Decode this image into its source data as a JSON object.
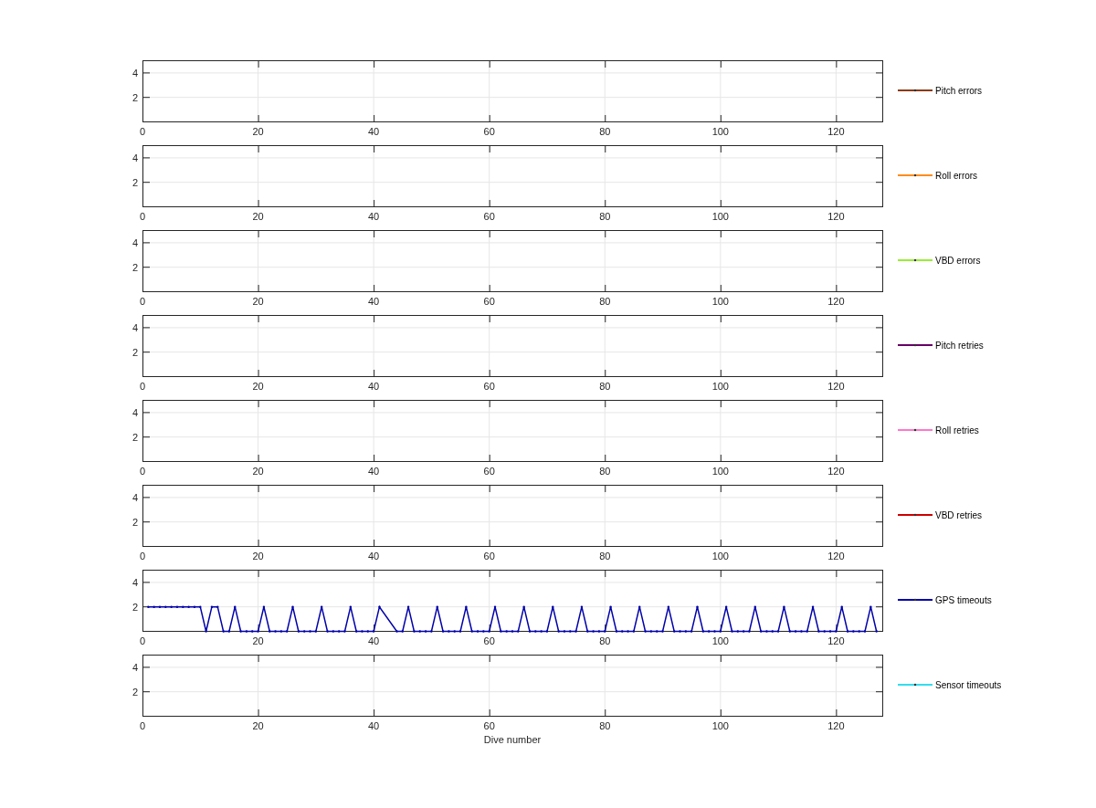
{
  "figure": {
    "subplots": [
      {
        "kind": "empty",
        "yticks": [
          "4",
          "2"
        ],
        "xticks": [
          "0",
          "20",
          "40",
          "60",
          "80",
          "100",
          "120"
        ],
        "legend": {
          "label": "Pitch errors",
          "color": "#8b3a0f"
        }
      },
      {
        "kind": "empty",
        "yticks": [
          "4",
          "2"
        ],
        "xticks": [
          "0",
          "20",
          "40",
          "60",
          "80",
          "100",
          "120"
        ],
        "legend": {
          "label": "Roll errors",
          "color": "#ff8c1a"
        }
      },
      {
        "kind": "empty",
        "yticks": [
          "4",
          "2"
        ],
        "xticks": [
          "0",
          "20",
          "40",
          "60",
          "80",
          "100",
          "120"
        ],
        "legend": {
          "label": "VBD errors",
          "color": "#99ee33"
        }
      },
      {
        "kind": "empty",
        "yticks": [
          "4",
          "2"
        ],
        "xticks": [
          "0",
          "20",
          "40",
          "60",
          "80",
          "100",
          "120"
        ],
        "legend": {
          "label": "Pitch retries",
          "color": "#660066"
        }
      },
      {
        "kind": "empty",
        "yticks": [
          "4",
          "2"
        ],
        "xticks": [
          "0",
          "20",
          "40",
          "60",
          "80",
          "100",
          "120"
        ],
        "legend": {
          "label": "Roll retries",
          "color": "#ff77cc"
        }
      },
      {
        "kind": "empty",
        "yticks": [
          "4",
          "2"
        ],
        "xticks": [
          "0",
          "20",
          "40",
          "60",
          "80",
          "100",
          "120"
        ],
        "legend": {
          "label": "VBD retries",
          "color": "#cc0000"
        }
      },
      {
        "kind": "chart",
        "chart_data": {
          "type": "line",
          "grid": true,
          "x": [
            1,
            2,
            3,
            4,
            5,
            6,
            7,
            8,
            9,
            10,
            11,
            12,
            13,
            14,
            15,
            16,
            17,
            18,
            19,
            20,
            21,
            22,
            23,
            24,
            25,
            26,
            27,
            28,
            29,
            30,
            31,
            32,
            33,
            34,
            35,
            36,
            37,
            38,
            39,
            40,
            41,
            44,
            45,
            46,
            47,
            48,
            49,
            50,
            51,
            52,
            53,
            54,
            55,
            56,
            57,
            58,
            59,
            60,
            61,
            62,
            63,
            64,
            65,
            66,
            67,
            68,
            69,
            70,
            71,
            72,
            73,
            74,
            75,
            76,
            77,
            78,
            79,
            80,
            81,
            82,
            83,
            84,
            85,
            86,
            87,
            88,
            89,
            90,
            91,
            92,
            93,
            94,
            95,
            96,
            97,
            98,
            99,
            100,
            101,
            102,
            103,
            104,
            105,
            106,
            107,
            108,
            109,
            110,
            111,
            112,
            113,
            114,
            115,
            116,
            117,
            118,
            119,
            120,
            121,
            122,
            123,
            124,
            125,
            126,
            127
          ],
          "series": [
            {
              "name": "GPS timeouts",
              "color": "#0000aa",
              "values": [
                2,
                2,
                2,
                2,
                2,
                2,
                2,
                2,
                2,
                2,
                0,
                2,
                2,
                0,
                0,
                2,
                0,
                0,
                0,
                0,
                2,
                0,
                0,
                0,
                0,
                2,
                0,
                0,
                0,
                0,
                2,
                0,
                0,
                0,
                0,
                2,
                0,
                0,
                0,
                0,
                2,
                0,
                0,
                2,
                0,
                0,
                0,
                0,
                2,
                0,
                0,
                0,
                0,
                2,
                0,
                0,
                0,
                0,
                2,
                0,
                0,
                0,
                0,
                2,
                0,
                0,
                0,
                0,
                2,
                0,
                0,
                0,
                0,
                2,
                0,
                0,
                0,
                0,
                2,
                0,
                0,
                0,
                0,
                2,
                0,
                0,
                0,
                0,
                2,
                0,
                0,
                0,
                0,
                2,
                0,
                0,
                0,
                0,
                2,
                0,
                0,
                0,
                0,
                2,
                0,
                0,
                0,
                0,
                2,
                0,
                0,
                0,
                0,
                2,
                0,
                0,
                0,
                0,
                2,
                0,
                0,
                0,
                0,
                2,
                0
              ]
            }
          ],
          "xlim": [
            0,
            128
          ],
          "ylim": [
            0,
            5
          ],
          "xticks": [
            0,
            20,
            40,
            60,
            80,
            100,
            120
          ],
          "yticks": [
            2,
            4
          ]
        }
      },
      {
        "kind": "empty",
        "yticks": [
          "4",
          "2"
        ],
        "xticks": [
          "0",
          "20",
          "40",
          "60",
          "80",
          "100",
          "120"
        ],
        "xlabel": "Dive number",
        "legend": {
          "label": "Sensor timeouts",
          "color": "#33ddee"
        }
      }
    ]
  }
}
